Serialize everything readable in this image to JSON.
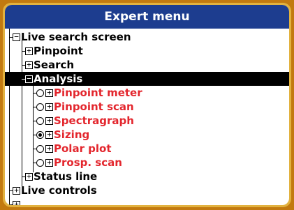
{
  "menu": {
    "title": "Expert menu",
    "items": [
      {
        "label": "Live search screen",
        "expander": "minus"
      },
      {
        "label": "Pinpoint",
        "expander": "plus"
      },
      {
        "label": "Search",
        "expander": "plus"
      },
      {
        "label": "Analysis",
        "expander": "minus",
        "selected": true
      },
      {
        "label": "Pinpoint meter",
        "expander": "plus",
        "radio": "off"
      },
      {
        "label": "Pinpoint scan",
        "expander": "plus",
        "radio": "off"
      },
      {
        "label": "Spectragraph",
        "expander": "plus",
        "radio": "off"
      },
      {
        "label": "Sizing",
        "expander": "plus",
        "radio": "on"
      },
      {
        "label": "Polar plot",
        "expander": "plus",
        "radio": "off"
      },
      {
        "label": "Prosp. scan",
        "expander": "plus",
        "radio": "off"
      },
      {
        "label": "Status line",
        "expander": "plus"
      },
      {
        "label": "Live controls",
        "expander": "plus"
      }
    ]
  },
  "colors": {
    "title_bg": "#1d3d8f",
    "frame": "#e2b23f",
    "option_text": "#e3262d",
    "selected_bg": "#000000"
  }
}
